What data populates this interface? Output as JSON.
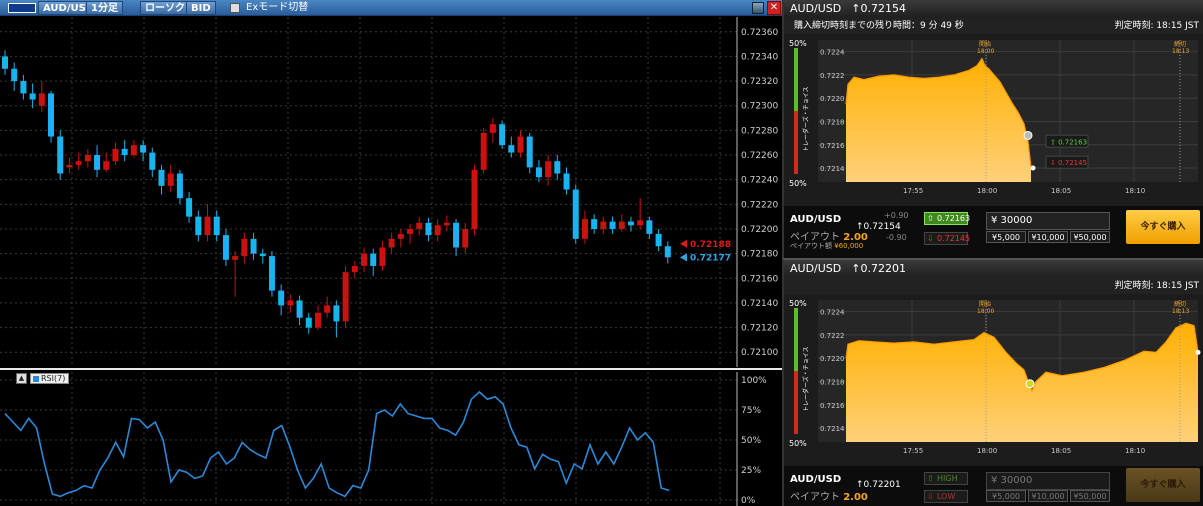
{
  "left_window": {
    "toolbar": {
      "pair": "AUD/USD",
      "timeframe": "1分足",
      "chart_type": "ローソク",
      "price_type": "BID",
      "ex_mode_label": "Exモード切替",
      "close_glyph": "✕"
    },
    "price_axis": [
      "0.72360",
      "0.72340",
      "0.72320",
      "0.72300",
      "0.72280",
      "0.72260",
      "0.72240",
      "0.72220",
      "0.72200",
      "0.72180",
      "0.72160",
      "0.72140",
      "0.72120",
      "0.72100"
    ],
    "ask_label": "0.72188",
    "bid_label": "0.72177",
    "rsi_label": "RSI(7)",
    "rsi_axis": [
      "100%",
      "75%",
      "50%",
      "25%",
      "0%"
    ],
    "colors": {
      "up": "#cc1111",
      "down": "#19b4f0",
      "ask": "#e01818",
      "bid": "#2aa6e6",
      "rsi": "#2a8ad8"
    }
  },
  "chart_data": [
    {
      "type": "candlestick",
      "title": "AUD/USD 1分足",
      "ylim": [
        0.72088,
        0.72372
      ],
      "candles": [
        [
          0.7234,
          0.7233,
          0.72345,
          0.72325
        ],
        [
          0.7233,
          0.7232,
          0.72335,
          0.72312
        ],
        [
          0.7232,
          0.7231,
          0.72325,
          0.72305
        ],
        [
          0.7231,
          0.72305,
          0.72318,
          0.72298
        ],
        [
          0.723,
          0.7231,
          0.7232,
          0.72295
        ],
        [
          0.7231,
          0.72275,
          0.72312,
          0.7227
        ],
        [
          0.72275,
          0.72245,
          0.7228,
          0.7224
        ],
        [
          0.7225,
          0.72252,
          0.72258,
          0.72245
        ],
        [
          0.72252,
          0.72255,
          0.72262,
          0.72248
        ],
        [
          0.72255,
          0.7226,
          0.72265,
          0.7225
        ],
        [
          0.7226,
          0.72248,
          0.72268,
          0.72242
        ],
        [
          0.72248,
          0.72255,
          0.72262,
          0.72246
        ],
        [
          0.72255,
          0.72265,
          0.7227,
          0.72252
        ],
        [
          0.72265,
          0.7226,
          0.72272,
          0.72255
        ],
        [
          0.7226,
          0.72268,
          0.72272,
          0.72258
        ],
        [
          0.72268,
          0.72262,
          0.72272,
          0.72255
        ],
        [
          0.72262,
          0.72248,
          0.72266,
          0.72242
        ],
        [
          0.72248,
          0.72235,
          0.72252,
          0.72228
        ],
        [
          0.72235,
          0.72245,
          0.72252,
          0.7223
        ],
        [
          0.72245,
          0.72225,
          0.72248,
          0.7222
        ],
        [
          0.72225,
          0.7221,
          0.7223,
          0.72205
        ],
        [
          0.7221,
          0.72195,
          0.72215,
          0.7219
        ],
        [
          0.72195,
          0.7221,
          0.7222,
          0.7219
        ],
        [
          0.7221,
          0.72195,
          0.72215,
          0.7219
        ],
        [
          0.72195,
          0.72175,
          0.722,
          0.7217
        ],
        [
          0.72175,
          0.72178,
          0.72182,
          0.72145
        ],
        [
          0.72178,
          0.72192,
          0.72197,
          0.72172
        ],
        [
          0.72192,
          0.7218,
          0.72197,
          0.72175
        ],
        [
          0.7218,
          0.72178,
          0.72184,
          0.72172
        ],
        [
          0.72178,
          0.7215,
          0.72182,
          0.72145
        ],
        [
          0.7215,
          0.72138,
          0.72155,
          0.7213
        ],
        [
          0.72138,
          0.72142,
          0.72147,
          0.72132
        ],
        [
          0.72142,
          0.72128,
          0.72146,
          0.72122
        ],
        [
          0.72128,
          0.7212,
          0.72132,
          0.72115
        ],
        [
          0.7212,
          0.72132,
          0.72138,
          0.72118
        ],
        [
          0.72132,
          0.72138,
          0.72145,
          0.72128
        ],
        [
          0.72138,
          0.72125,
          0.72142,
          0.72112
        ],
        [
          0.72125,
          0.72165,
          0.7217,
          0.7212
        ],
        [
          0.72165,
          0.7217,
          0.72174,
          0.7216
        ],
        [
          0.7217,
          0.7218,
          0.72185,
          0.72165
        ],
        [
          0.7218,
          0.7217,
          0.72184,
          0.72162
        ],
        [
          0.7217,
          0.72185,
          0.7219,
          0.72166
        ],
        [
          0.72185,
          0.72192,
          0.72197,
          0.7218
        ],
        [
          0.72192,
          0.72196,
          0.722,
          0.72185
        ],
        [
          0.72196,
          0.722,
          0.72204,
          0.72188
        ],
        [
          0.722,
          0.72205,
          0.7221,
          0.72195
        ],
        [
          0.72205,
          0.72195,
          0.72209,
          0.7219
        ],
        [
          0.72195,
          0.72203,
          0.72208,
          0.7219
        ],
        [
          0.72203,
          0.72205,
          0.72211,
          0.72198
        ],
        [
          0.72205,
          0.72185,
          0.72208,
          0.72178
        ],
        [
          0.72185,
          0.722,
          0.72205,
          0.7218
        ],
        [
          0.722,
          0.72248,
          0.72252,
          0.72195
        ],
        [
          0.72248,
          0.72278,
          0.72282,
          0.72245
        ],
        [
          0.72278,
          0.72285,
          0.7229,
          0.7227
        ],
        [
          0.72285,
          0.72268,
          0.72288,
          0.72265
        ],
        [
          0.72268,
          0.72262,
          0.72275,
          0.72258
        ],
        [
          0.72262,
          0.72275,
          0.7228,
          0.72258
        ],
        [
          0.72275,
          0.7225,
          0.72278,
          0.72245
        ],
        [
          0.7225,
          0.72242,
          0.72256,
          0.72238
        ],
        [
          0.72242,
          0.72255,
          0.7226,
          0.72235
        ],
        [
          0.72255,
          0.72245,
          0.7226,
          0.7224
        ],
        [
          0.72245,
          0.72232,
          0.7225,
          0.72228
        ],
        [
          0.72232,
          0.72192,
          0.72236,
          0.72188
        ],
        [
          0.72192,
          0.72208,
          0.72215,
          0.72188
        ],
        [
          0.72208,
          0.722,
          0.72212,
          0.72196
        ],
        [
          0.722,
          0.72206,
          0.7221,
          0.72196
        ],
        [
          0.72206,
          0.722,
          0.7221,
          0.72196
        ],
        [
          0.722,
          0.72206,
          0.72212,
          0.72198
        ],
        [
          0.72206,
          0.72203,
          0.7221,
          0.72198
        ],
        [
          0.72203,
          0.72207,
          0.72225,
          0.722
        ],
        [
          0.72207,
          0.72196,
          0.7221,
          0.72192
        ],
        [
          0.72196,
          0.72186,
          0.722,
          0.72182
        ],
        [
          0.72186,
          0.72177,
          0.7219,
          0.72172
        ]
      ]
    },
    {
      "type": "line",
      "title": "RSI(7)",
      "ylim": [
        0,
        100
      ],
      "series": [
        {
          "name": "RSI(7)",
          "values": [
            72,
            65,
            58,
            68,
            60,
            30,
            5,
            3,
            6,
            8,
            12,
            10,
            25,
            35,
            48,
            36,
            68,
            67,
            60,
            65,
            50,
            15,
            25,
            23,
            18,
            20,
            35,
            40,
            30,
            35,
            48,
            42,
            38,
            35,
            58,
            62,
            45,
            25,
            10,
            18,
            30,
            10,
            6,
            3,
            12,
            10,
            25,
            72,
            75,
            70,
            80,
            72,
            70,
            68,
            68,
            60,
            58,
            54,
            65,
            84,
            90,
            84,
            86,
            80,
            60,
            46,
            44,
            26,
            38,
            34,
            32,
            14,
            30,
            26,
            46,
            30,
            40,
            30,
            44,
            60,
            50,
            56,
            48,
            10,
            8
          ]
        }
      ]
    }
  ],
  "panel_top": {
    "header_pair": "AUD/USD",
    "header_price": "↑0.72154",
    "remaining_label": "購入締切時刻までの残り時間：9 分 49 秒",
    "judgement": "判定時刻: 18:15 JST",
    "trader_choice": "トレーダーズ・チョイス",
    "pct_top": "50%",
    "pct_bot": "50%",
    "y_ticks": [
      "0.7224",
      "0.7222",
      "0.7220",
      "0.7218",
      "0.7216",
      "0.7214"
    ],
    "x_ticks": [
      "17:55",
      "18:00",
      "18:05",
      "18:10"
    ],
    "start_label": "開始",
    "start_time": "18:00",
    "end_label": "締切",
    "end_time": "18:13",
    "high_tag": "0.72163",
    "low_tag": "0.72145",
    "bottom": {
      "pair": "AUD/USD",
      "payout_label": "ペイアウト",
      "payout_value": "2.00",
      "payout_amount_label": "ペイアウト額",
      "payout_amount": "¥60,000",
      "price": "↑0.72154",
      "up_diff": "+0.90",
      "down_diff": "-0.90",
      "btn_high": "0.72163",
      "btn_low": "0.72145",
      "amount": "¥ 30000",
      "chip1": "¥5,000",
      "chip2": "¥10,000",
      "chip3": "¥50,000",
      "buy_label": "今すぐ購入"
    }
  },
  "panel_bottom": {
    "header_pair": "AUD/USD",
    "header_price": "↑0.72201",
    "judgement": "判定時刻: 18:15 JST",
    "trader_choice": "トレーダーズ・チョイス",
    "pct_top": "50%",
    "pct_bot": "50%",
    "y_ticks": [
      "0.7224",
      "0.7222",
      "0.7220",
      "0.7218",
      "0.7216",
      "0.7214"
    ],
    "x_ticks": [
      "17:55",
      "18:00",
      "18:05",
      "18:10"
    ],
    "start_label": "開始",
    "start_time": "18:00",
    "end_label": "締切",
    "end_time": "18:13",
    "bottom": {
      "pair": "AUD/USD",
      "payout_label": "ペイアウト",
      "payout_value": "2.00",
      "price": "↑0.72201",
      "btn_high": "HIGH",
      "btn_low": "LOW",
      "amount": "¥ 30000",
      "chip1": "¥5,000",
      "chip2": "¥10,000",
      "chip3": "¥50,000",
      "buy_label": "今すぐ購入"
    }
  }
}
